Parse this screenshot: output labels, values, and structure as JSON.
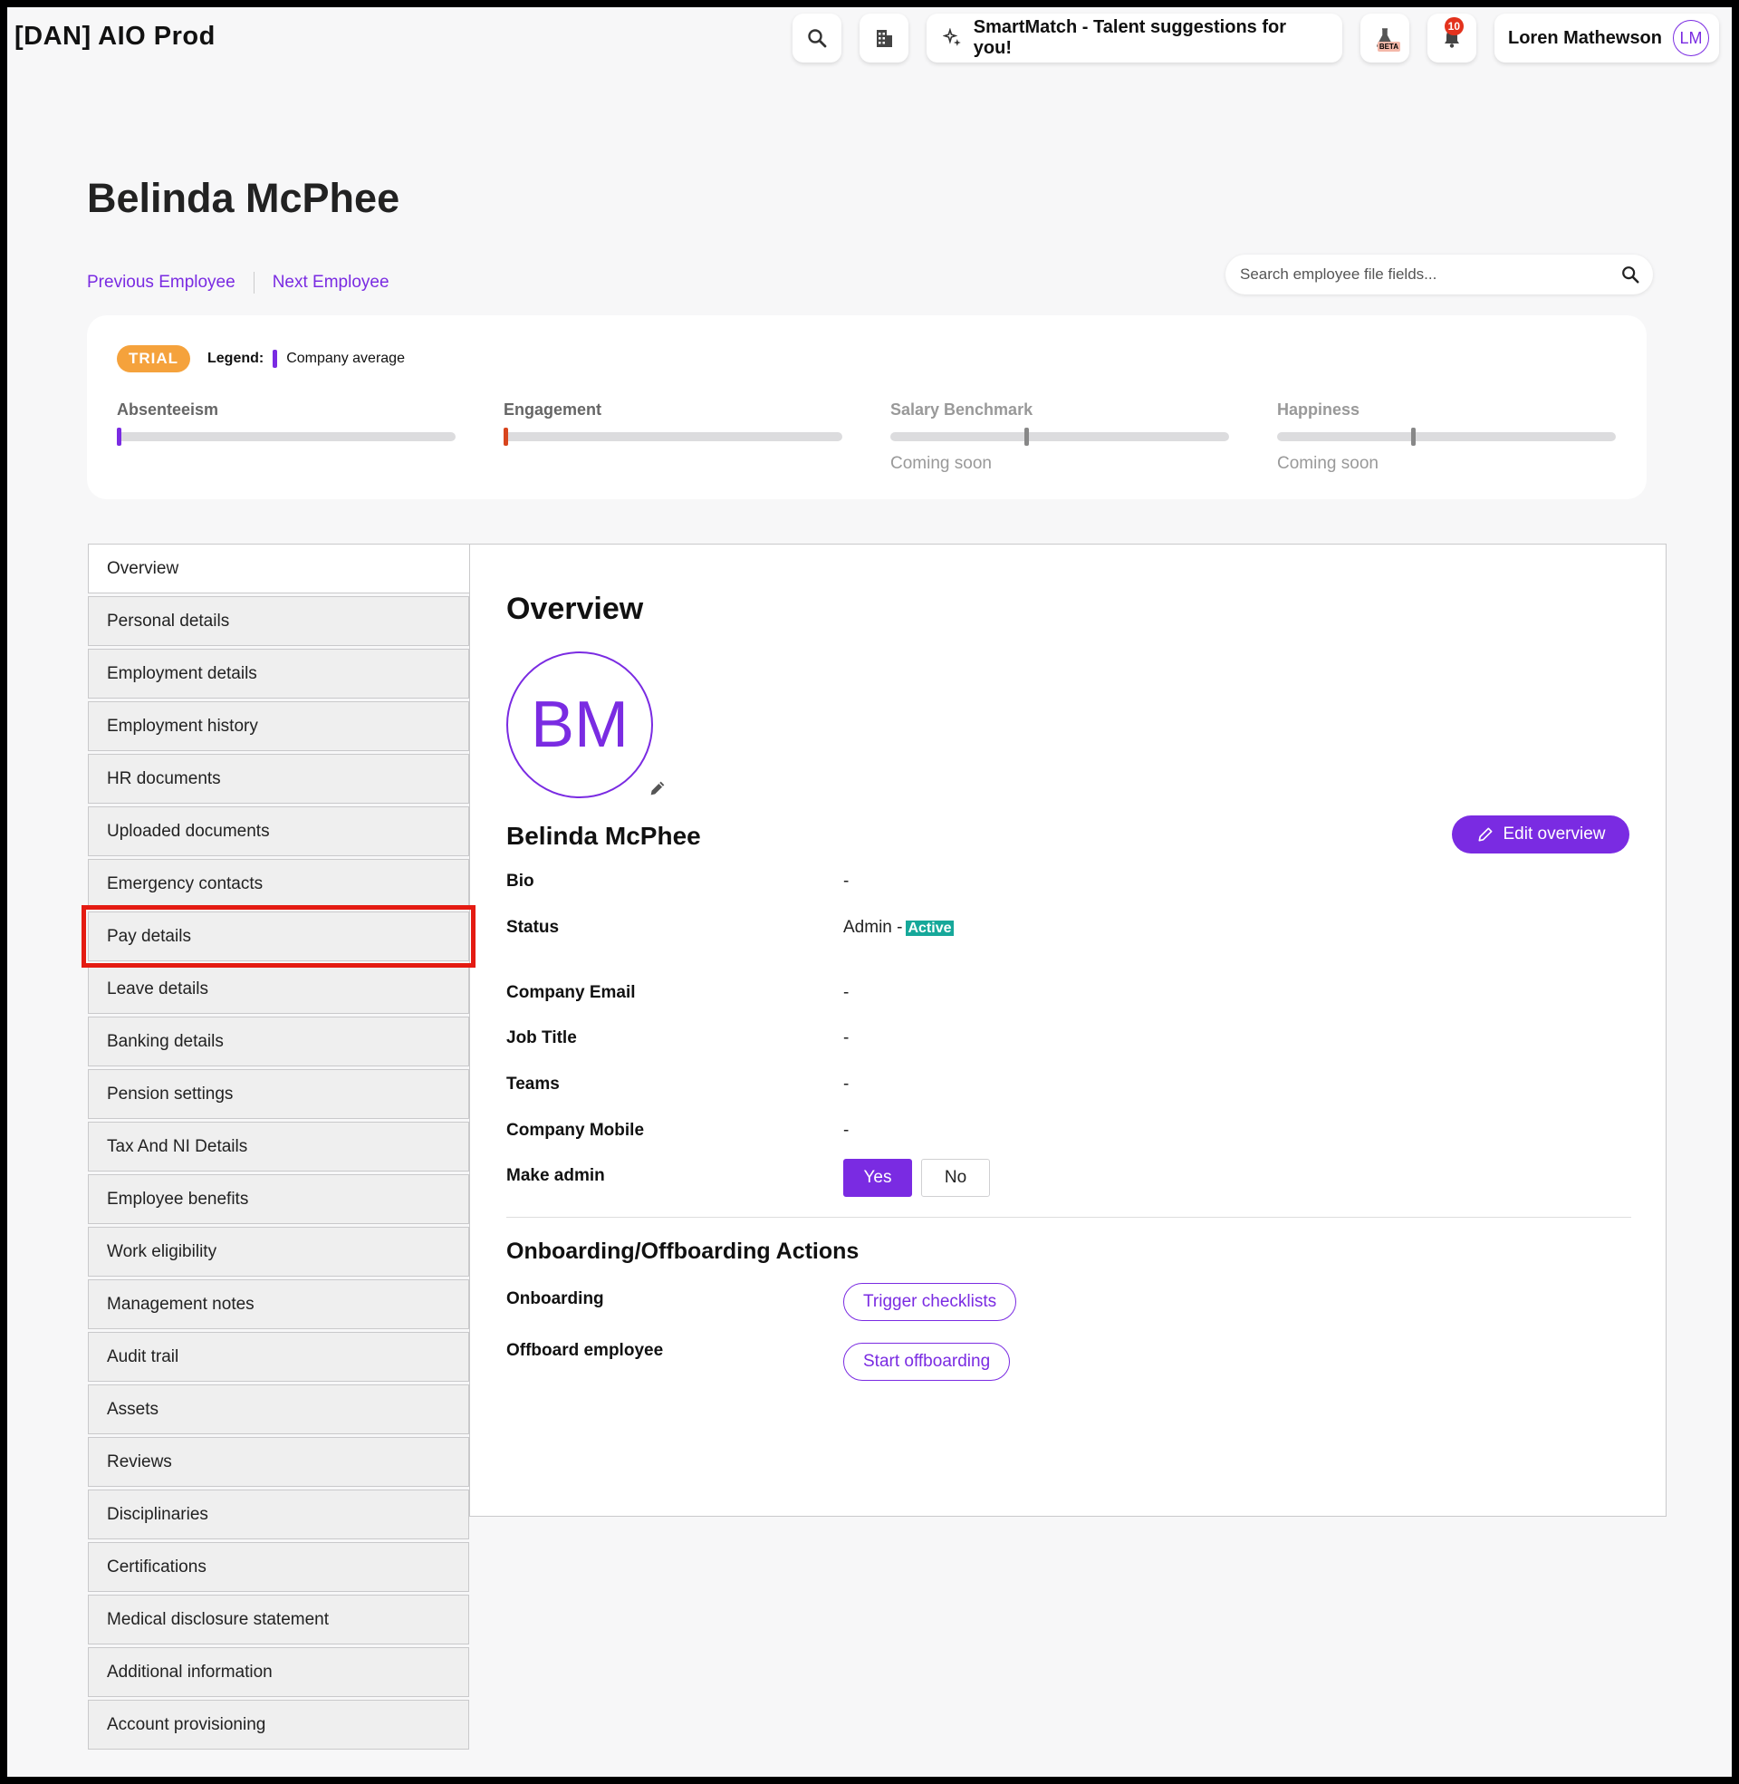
{
  "app": {
    "title": "[DAN] AIO Prod"
  },
  "topbar": {
    "smartmatch_label": "SmartMatch - Talent suggestions for you!",
    "beta_tag": "BETA",
    "notification_count": "10",
    "user_name": "Loren Mathewson",
    "user_initials": "LM"
  },
  "page": {
    "title": "Belinda McPhee",
    "prev_label": "Previous Employee",
    "next_label": "Next Employee",
    "search_placeholder": "Search employee file fields..."
  },
  "metrics": {
    "trial_label": "TRIAL",
    "legend_label": "Legend:",
    "legend_item": "Company average",
    "accent": "#7a2be2",
    "items": [
      {
        "label": "Absenteeism",
        "marker_color": "#7a2be2",
        "level": 0,
        "note": ""
      },
      {
        "label": "Engagement",
        "marker_color": "#d8451e",
        "level": 0,
        "note": ""
      },
      {
        "label": "Salary Benchmark",
        "marker_color": "#888888",
        "level": 0.4,
        "note": "Coming soon"
      },
      {
        "label": "Happiness",
        "marker_color": "#888888",
        "level": 0.4,
        "note": "Coming soon"
      }
    ]
  },
  "sidebar": {
    "items": [
      {
        "label": "Overview"
      },
      {
        "label": "Personal details"
      },
      {
        "label": "Employment details"
      },
      {
        "label": "Employment history"
      },
      {
        "label": "HR documents"
      },
      {
        "label": "Uploaded documents"
      },
      {
        "label": "Emergency contacts"
      },
      {
        "label": "Pay details"
      },
      {
        "label": "Leave details"
      },
      {
        "label": "Banking details"
      },
      {
        "label": "Pension settings"
      },
      {
        "label": "Tax And NI Details"
      },
      {
        "label": "Employee benefits"
      },
      {
        "label": "Work eligibility"
      },
      {
        "label": "Management notes"
      },
      {
        "label": "Audit trail"
      },
      {
        "label": "Assets"
      },
      {
        "label": "Reviews"
      },
      {
        "label": "Disciplinaries"
      },
      {
        "label": "Certifications"
      },
      {
        "label": "Medical disclosure statement"
      },
      {
        "label": "Additional information"
      },
      {
        "label": "Account provisioning"
      }
    ]
  },
  "overview": {
    "title": "Overview",
    "initials": "BM",
    "name": "Belinda McPhee",
    "edit_label": "Edit overview",
    "fields": {
      "bio_label": "Bio",
      "bio_value": "-",
      "status_label": "Status",
      "status_value": "Admin -",
      "status_badge": "Active",
      "email_label": "Company Email",
      "email_value": "-",
      "job_label": "Job Title",
      "job_value": "-",
      "teams_label": "Teams",
      "teams_value": "-",
      "mobile_label": "Company Mobile",
      "mobile_value": "-",
      "admin_label": "Make admin",
      "admin_yes": "Yes",
      "admin_no": "No"
    },
    "actions": {
      "title": "Onboarding/Offboarding Actions",
      "onboarding_label": "Onboarding",
      "onboarding_button": "Trigger checklists",
      "offboard_label": "Offboard employee",
      "offboard_button": "Start offboarding"
    }
  }
}
